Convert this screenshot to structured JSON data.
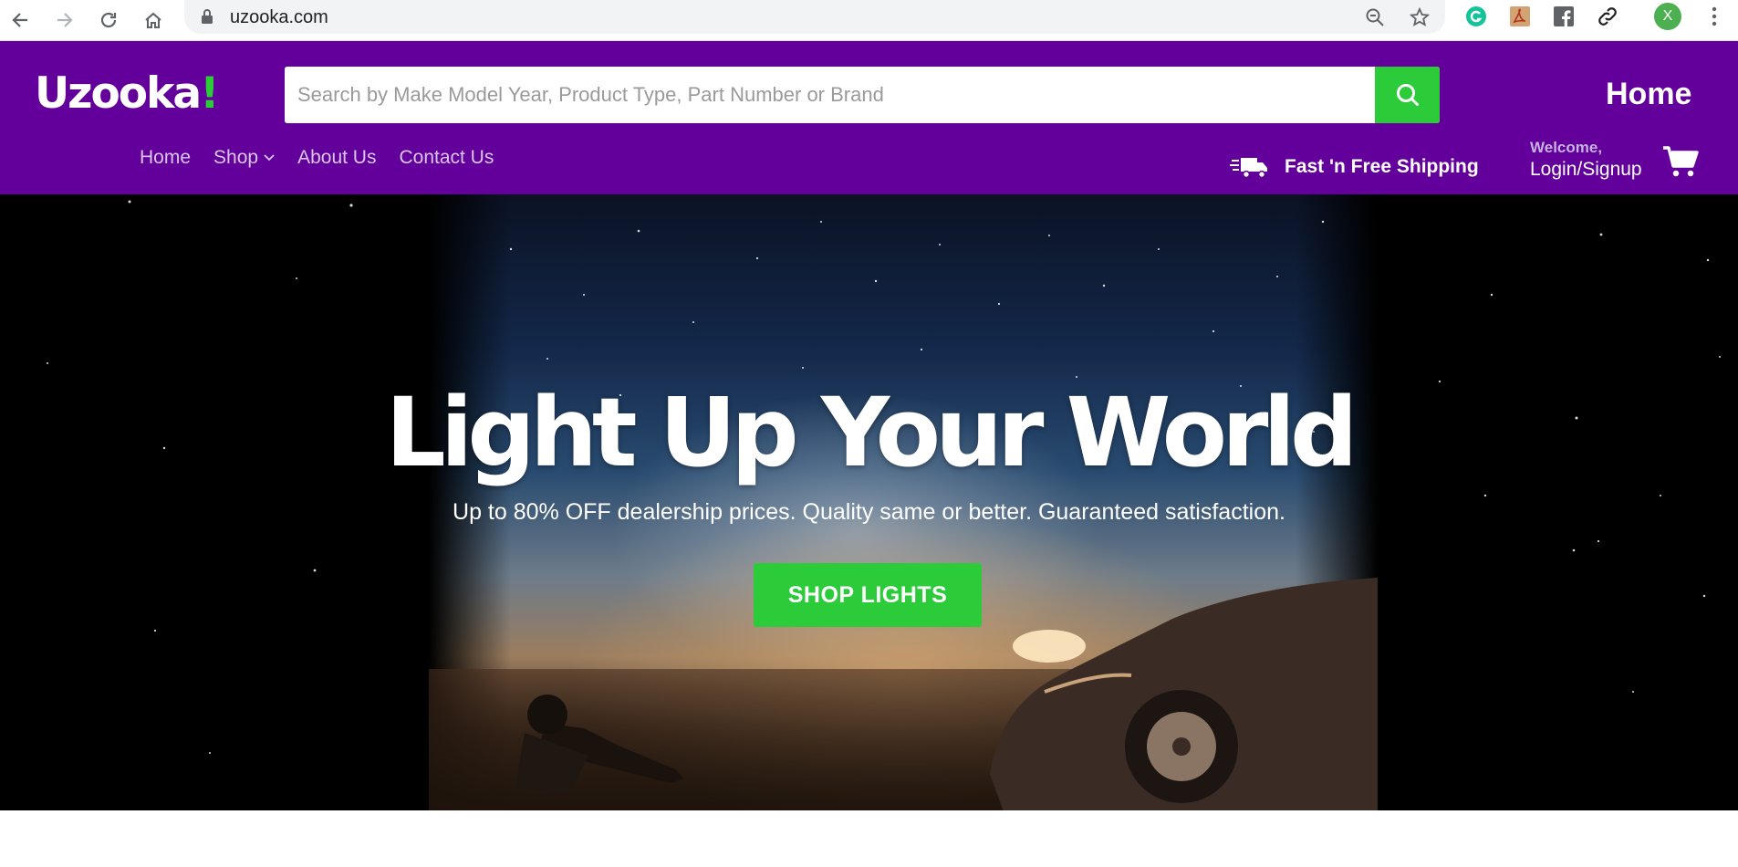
{
  "browser": {
    "url": "uzooka.com",
    "profile_initial": "X"
  },
  "header": {
    "logo_text": "Uzooka",
    "logo_accent": "!",
    "search_placeholder": "Search by Make Model Year, Product Type, Part Number or Brand",
    "home_label": "Home",
    "nav": [
      {
        "label": "Home"
      },
      {
        "label": "Shop"
      },
      {
        "label": "About Us"
      },
      {
        "label": "Contact Us"
      }
    ],
    "shipping_label": "Fast 'n Free Shipping",
    "welcome_label": "Welcome,",
    "login_label": "Login/Signup"
  },
  "hero": {
    "title": "Light Up Your World",
    "subtitle": "Up to 80% OFF dealership prices. Quality same or better. Guaranteed satisfaction.",
    "button_label": "SHOP LIGHTS"
  },
  "colors": {
    "brand_purple": "#63009b",
    "accent_green": "#2ccb3a"
  }
}
